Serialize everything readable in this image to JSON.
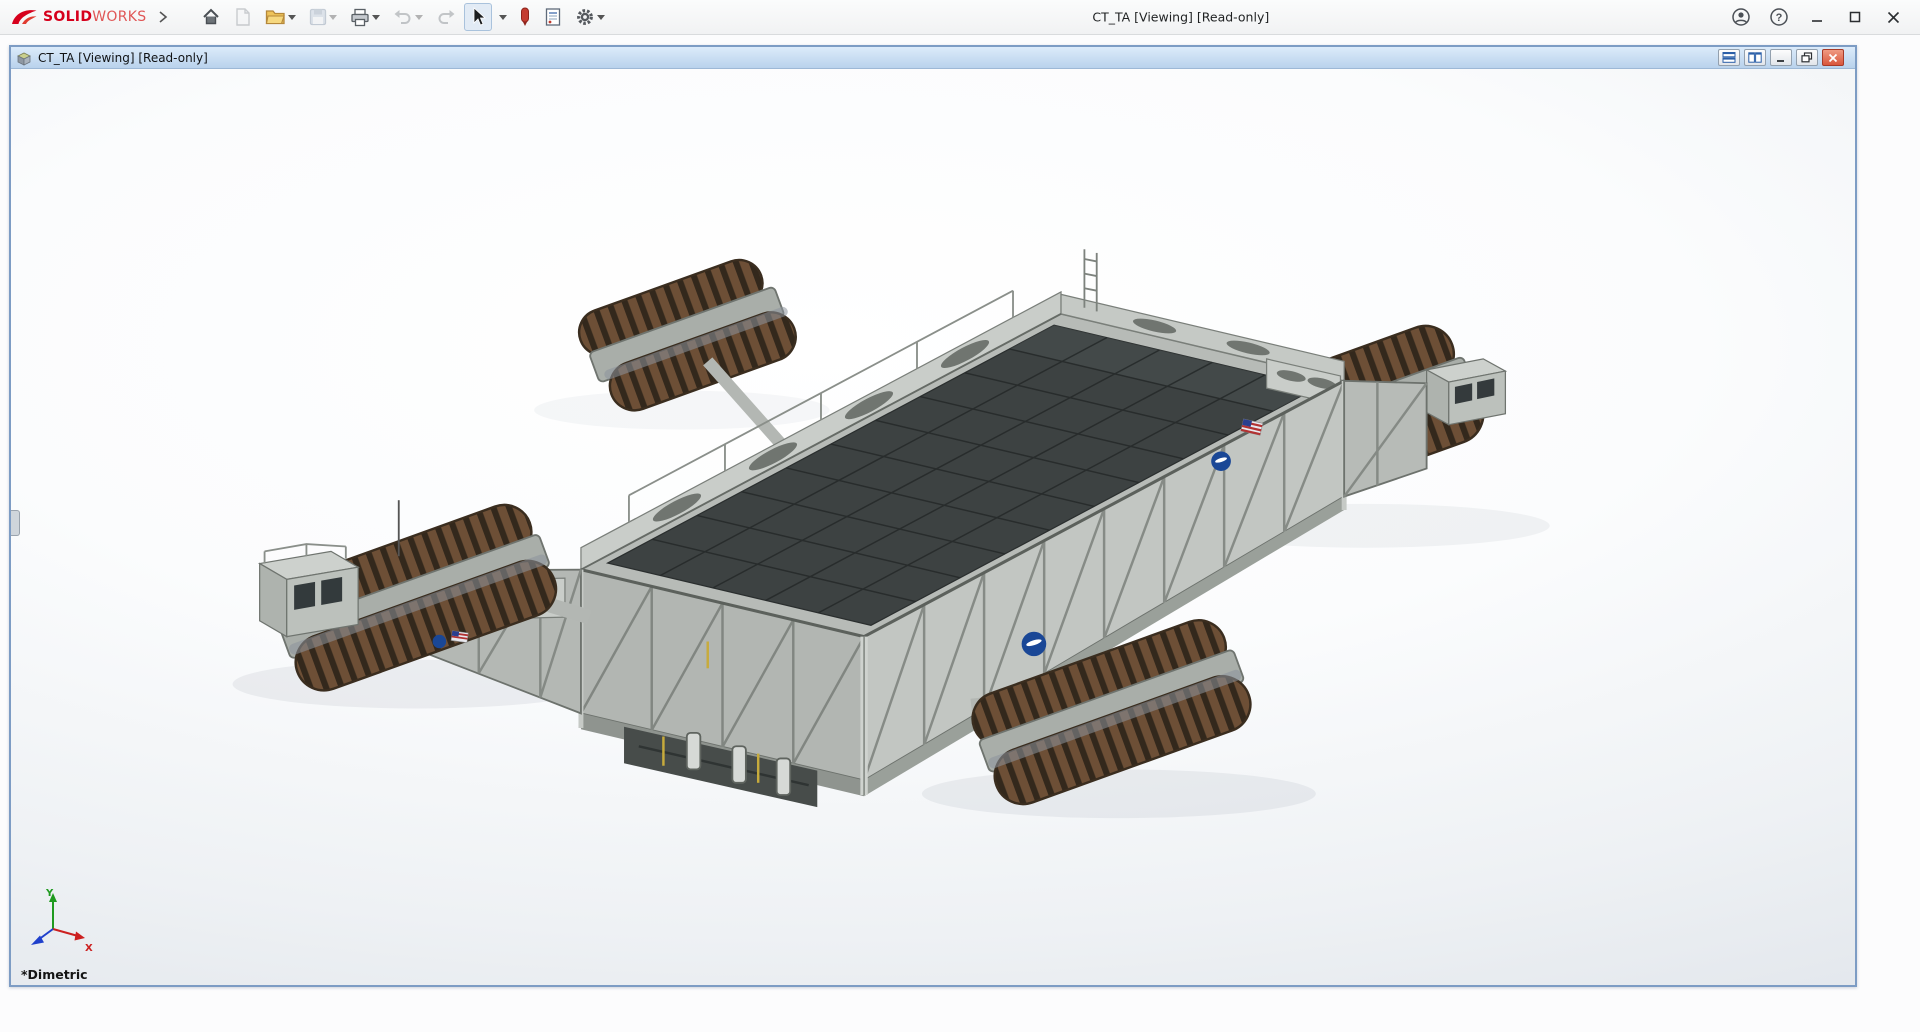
{
  "app": {
    "title": "CT_TA [Viewing] [Read-only]",
    "brand": {
      "solid": "SOLID",
      "works": "WORKS",
      "accent_color": "#d6001c"
    },
    "help_glyph": "?",
    "toolbar_icons": [
      "expand-arrow-icon",
      "home-icon",
      "new-document-icon",
      "open-folder-icon",
      "save-icon",
      "print-icon",
      "undo-icon",
      "redo-icon",
      "select-cursor-icon",
      "touch-pen-icon",
      "file-properties-icon",
      "options-gear-icon"
    ],
    "window_icons": [
      "account-icon",
      "help-icon",
      "minimize-icon",
      "maximize-icon",
      "close-icon"
    ]
  },
  "document_window": {
    "title": "CT_TA [Viewing] [Read-only]",
    "control_icons": [
      "tile-top-bottom-icon",
      "tile-side-by-side-icon",
      "minimize-icon",
      "restore-icon",
      "close-icon"
    ],
    "viewport": {
      "model": "NASA crawler-transporter CAD assembly",
      "view_orientation_label": "*Dimetric",
      "triad_labels": {
        "x": "X",
        "y": "Y"
      }
    }
  },
  "colors": {
    "doc_titlebar_top": "#dcebfa",
    "doc_titlebar_bottom": "#b9d2ec",
    "doc_border": "#7d9cc4",
    "close_button_red": "#d9563c",
    "track_brown": "#6d4f36",
    "deck_gray": "#3d4242",
    "structure_gray": "#b7bbb7",
    "nasa_blue": "#1a4796",
    "viewport_gradient_top": "#ffffff",
    "viewport_gradient_bottom": "#dce1e8"
  }
}
